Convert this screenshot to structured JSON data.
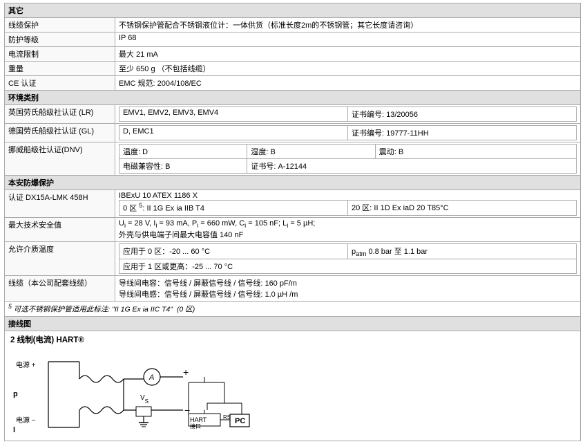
{
  "sections": {
    "other": {
      "title": "其它",
      "rows": [
        {
          "label": "线缆保护",
          "value": "不锈钢保护管配合不锈钢液位计：一体供货（标准长度2m的不锈钢管；其它长度请咨询）"
        },
        {
          "label": "防护等级",
          "value": "IP 68"
        },
        {
          "label": "电流限制",
          "value": "最大 21 mA"
        },
        {
          "label": "重量",
          "value": "至少 650 g （不包括线缆）"
        },
        {
          "label": "CE 认证",
          "value": "EMC 规范: 2004/108/EC"
        }
      ]
    },
    "environment": {
      "title": "环境类别",
      "rows": [
        {
          "label": "英国劳氏船级社认证 (LR)",
          "cols": [
            "EMV1, EMV2, EMV3, EMV4",
            "证书编号: 13/20056"
          ]
        },
        {
          "label": "德国劳氏船级社认证 (GL)",
          "cols": [
            "D, EMC1",
            "证书编号: 19777-11HH"
          ]
        },
        {
          "label": "挪威船级社认证(DNV)",
          "line1_cols": [
            "温度: D",
            "湿度: B",
            "震动: B"
          ],
          "line2_cols": [
            "电磁兼容性: B",
            "证书号: A-12144"
          ]
        }
      ]
    },
    "intrinsic": {
      "title": "本安防爆保护",
      "rows": [
        {
          "label": "认证 DX15A-LMK 458H",
          "line1": "IBExU 10 ATEX 1186 X",
          "line2_cols": [
            "0 区 ⁵: II 1G Ex ia IIB T4",
            "20 区: II 1D Ex iaD 20 T85°C"
          ]
        },
        {
          "label": "最大技术安全值",
          "line1": "Ui = 28 V, Ii = 93 mA, Pi = 660 mW, Ci = 105 nF; Li = 5 µH;",
          "line2": "外壳与供电端子间最大电容值 140 nF"
        },
        {
          "label": "允许介质温度",
          "line1_cols": [
            "应用于 0 区：-20 ... 60 °C",
            "patm 0.8 bar 至 1.1 bar"
          ],
          "line2": "应用于 1 区或更高：-25 ... 70 °C"
        },
        {
          "label": "线缆（本公司配套线缆）",
          "line1": "导线间电容：信号线 / 屏蔽信号线 / 信号线: 160 pF/m",
          "line2": "导线间电感：信号线 / 屏蔽信号线 / 信号线: 1.0 µH /m"
        }
      ],
      "note": "⁵ 可选不锈钢保护管适用此标注: \"II 1G Ex ia IIC T4\"  (0 区)"
    },
    "wiring": {
      "title": "接线图",
      "subtitle": "2 线制(电流) HART®"
    }
  }
}
